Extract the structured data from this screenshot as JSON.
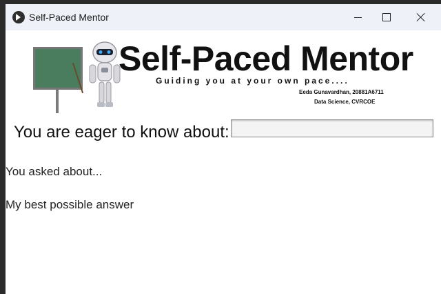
{
  "window": {
    "title": "Self-Paced Mentor",
    "controls": [
      "minimize",
      "maximize",
      "close"
    ]
  },
  "banner": {
    "brand_title": "Self-Paced Mentor",
    "tagline": "Guiding you at your own pace....",
    "author_line1": "Eeda Gunavardhan, 20881A6711",
    "author_line2": "Data Science, CVRCOE"
  },
  "main": {
    "prompt_label": "You are eager to know about:",
    "question_value": "",
    "asked_label": "You asked about...",
    "answer_label": "My best possible answer"
  },
  "colors": {
    "titlebar_bg": "#eef2f8",
    "window_bg": "#ffffff",
    "board_green": "#4a7c5e"
  }
}
